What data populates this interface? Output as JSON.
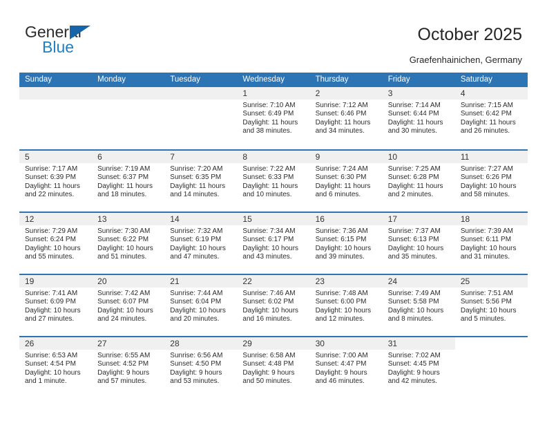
{
  "brand": {
    "name_part1": "General",
    "name_part2": "Blue",
    "accent_color": "#1f7ec4",
    "triangle_color": "#1565a8"
  },
  "header": {
    "title": "October 2025",
    "subtitle": "Graefenhainichen, Germany"
  },
  "calendar": {
    "header_bg": "#2d74b5",
    "daynum_bg": "#f0f0f0",
    "weekday_names": [
      "Sunday",
      "Monday",
      "Tuesday",
      "Wednesday",
      "Thursday",
      "Friday",
      "Saturday"
    ],
    "weeks": [
      [
        {
          "day": "",
          "empty": true
        },
        {
          "day": "",
          "empty": true
        },
        {
          "day": "",
          "empty": true
        },
        {
          "day": "1",
          "sunrise": "Sunrise: 7:10 AM",
          "sunset": "Sunset: 6:49 PM",
          "daylight1": "Daylight: 11 hours",
          "daylight2": "and 38 minutes."
        },
        {
          "day": "2",
          "sunrise": "Sunrise: 7:12 AM",
          "sunset": "Sunset: 6:46 PM",
          "daylight1": "Daylight: 11 hours",
          "daylight2": "and 34 minutes."
        },
        {
          "day": "3",
          "sunrise": "Sunrise: 7:14 AM",
          "sunset": "Sunset: 6:44 PM",
          "daylight1": "Daylight: 11 hours",
          "daylight2": "and 30 minutes."
        },
        {
          "day": "4",
          "sunrise": "Sunrise: 7:15 AM",
          "sunset": "Sunset: 6:42 PM",
          "daylight1": "Daylight: 11 hours",
          "daylight2": "and 26 minutes."
        }
      ],
      [
        {
          "day": "5",
          "sunrise": "Sunrise: 7:17 AM",
          "sunset": "Sunset: 6:39 PM",
          "daylight1": "Daylight: 11 hours",
          "daylight2": "and 22 minutes."
        },
        {
          "day": "6",
          "sunrise": "Sunrise: 7:19 AM",
          "sunset": "Sunset: 6:37 PM",
          "daylight1": "Daylight: 11 hours",
          "daylight2": "and 18 minutes."
        },
        {
          "day": "7",
          "sunrise": "Sunrise: 7:20 AM",
          "sunset": "Sunset: 6:35 PM",
          "daylight1": "Daylight: 11 hours",
          "daylight2": "and 14 minutes."
        },
        {
          "day": "8",
          "sunrise": "Sunrise: 7:22 AM",
          "sunset": "Sunset: 6:33 PM",
          "daylight1": "Daylight: 11 hours",
          "daylight2": "and 10 minutes."
        },
        {
          "day": "9",
          "sunrise": "Sunrise: 7:24 AM",
          "sunset": "Sunset: 6:30 PM",
          "daylight1": "Daylight: 11 hours",
          "daylight2": "and 6 minutes."
        },
        {
          "day": "10",
          "sunrise": "Sunrise: 7:25 AM",
          "sunset": "Sunset: 6:28 PM",
          "daylight1": "Daylight: 11 hours",
          "daylight2": "and 2 minutes."
        },
        {
          "day": "11",
          "sunrise": "Sunrise: 7:27 AM",
          "sunset": "Sunset: 6:26 PM",
          "daylight1": "Daylight: 10 hours",
          "daylight2": "and 58 minutes."
        }
      ],
      [
        {
          "day": "12",
          "sunrise": "Sunrise: 7:29 AM",
          "sunset": "Sunset: 6:24 PM",
          "daylight1": "Daylight: 10 hours",
          "daylight2": "and 55 minutes."
        },
        {
          "day": "13",
          "sunrise": "Sunrise: 7:30 AM",
          "sunset": "Sunset: 6:22 PM",
          "daylight1": "Daylight: 10 hours",
          "daylight2": "and 51 minutes."
        },
        {
          "day": "14",
          "sunrise": "Sunrise: 7:32 AM",
          "sunset": "Sunset: 6:19 PM",
          "daylight1": "Daylight: 10 hours",
          "daylight2": "and 47 minutes."
        },
        {
          "day": "15",
          "sunrise": "Sunrise: 7:34 AM",
          "sunset": "Sunset: 6:17 PM",
          "daylight1": "Daylight: 10 hours",
          "daylight2": "and 43 minutes."
        },
        {
          "day": "16",
          "sunrise": "Sunrise: 7:36 AM",
          "sunset": "Sunset: 6:15 PM",
          "daylight1": "Daylight: 10 hours",
          "daylight2": "and 39 minutes."
        },
        {
          "day": "17",
          "sunrise": "Sunrise: 7:37 AM",
          "sunset": "Sunset: 6:13 PM",
          "daylight1": "Daylight: 10 hours",
          "daylight2": "and 35 minutes."
        },
        {
          "day": "18",
          "sunrise": "Sunrise: 7:39 AM",
          "sunset": "Sunset: 6:11 PM",
          "daylight1": "Daylight: 10 hours",
          "daylight2": "and 31 minutes."
        }
      ],
      [
        {
          "day": "19",
          "sunrise": "Sunrise: 7:41 AM",
          "sunset": "Sunset: 6:09 PM",
          "daylight1": "Daylight: 10 hours",
          "daylight2": "and 27 minutes."
        },
        {
          "day": "20",
          "sunrise": "Sunrise: 7:42 AM",
          "sunset": "Sunset: 6:07 PM",
          "daylight1": "Daylight: 10 hours",
          "daylight2": "and 24 minutes."
        },
        {
          "day": "21",
          "sunrise": "Sunrise: 7:44 AM",
          "sunset": "Sunset: 6:04 PM",
          "daylight1": "Daylight: 10 hours",
          "daylight2": "and 20 minutes."
        },
        {
          "day": "22",
          "sunrise": "Sunrise: 7:46 AM",
          "sunset": "Sunset: 6:02 PM",
          "daylight1": "Daylight: 10 hours",
          "daylight2": "and 16 minutes."
        },
        {
          "day": "23",
          "sunrise": "Sunrise: 7:48 AM",
          "sunset": "Sunset: 6:00 PM",
          "daylight1": "Daylight: 10 hours",
          "daylight2": "and 12 minutes."
        },
        {
          "day": "24",
          "sunrise": "Sunrise: 7:49 AM",
          "sunset": "Sunset: 5:58 PM",
          "daylight1": "Daylight: 10 hours",
          "daylight2": "and 8 minutes."
        },
        {
          "day": "25",
          "sunrise": "Sunrise: 7:51 AM",
          "sunset": "Sunset: 5:56 PM",
          "daylight1": "Daylight: 10 hours",
          "daylight2": "and 5 minutes."
        }
      ],
      [
        {
          "day": "26",
          "sunrise": "Sunrise: 6:53 AM",
          "sunset": "Sunset: 4:54 PM",
          "daylight1": "Daylight: 10 hours",
          "daylight2": "and 1 minute."
        },
        {
          "day": "27",
          "sunrise": "Sunrise: 6:55 AM",
          "sunset": "Sunset: 4:52 PM",
          "daylight1": "Daylight: 9 hours",
          "daylight2": "and 57 minutes."
        },
        {
          "day": "28",
          "sunrise": "Sunrise: 6:56 AM",
          "sunset": "Sunset: 4:50 PM",
          "daylight1": "Daylight: 9 hours",
          "daylight2": "and 53 minutes."
        },
        {
          "day": "29",
          "sunrise": "Sunrise: 6:58 AM",
          "sunset": "Sunset: 4:48 PM",
          "daylight1": "Daylight: 9 hours",
          "daylight2": "and 50 minutes."
        },
        {
          "day": "30",
          "sunrise": "Sunrise: 7:00 AM",
          "sunset": "Sunset: 4:47 PM",
          "daylight1": "Daylight: 9 hours",
          "daylight2": "and 46 minutes."
        },
        {
          "day": "31",
          "sunrise": "Sunrise: 7:02 AM",
          "sunset": "Sunset: 4:45 PM",
          "daylight1": "Daylight: 9 hours",
          "daylight2": "and 42 minutes."
        },
        {
          "day": "",
          "empty": true,
          "no_strip": true
        }
      ]
    ]
  }
}
